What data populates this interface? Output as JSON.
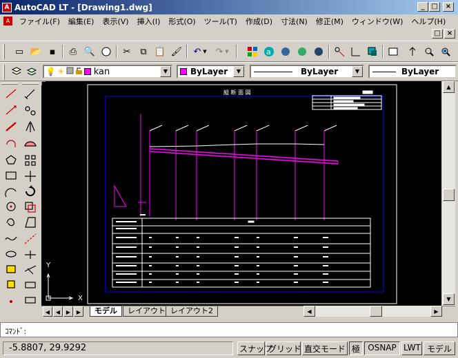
{
  "window": {
    "title": "AutoCAD LT - [Drawing1.dwg]",
    "minimize": "_",
    "maximize": "□",
    "close": "×",
    "app_icon": "A"
  },
  "menu": [
    "ファイル(F)",
    "編集(E)",
    "表示(V)",
    "挿入(I)",
    "形式(O)",
    "ツール(T)",
    "作成(D)",
    "寸法(N)",
    "修正(M)",
    "ウィンドウ(W)",
    "ヘルプ(H)"
  ],
  "layer": {
    "name": "kan",
    "color": "#ff00ff"
  },
  "props": {
    "color": "ByLayer",
    "linetype": "ByLayer",
    "lineweight": "ByLayer"
  },
  "drawing": {
    "title": "縦 断 面 図"
  },
  "ucs": {
    "x": "X",
    "y": "Y"
  },
  "tabs": [
    "モデル",
    "レイアウト1",
    "レイアウト2"
  ],
  "command": {
    "prompt": "ｺﾏﾝﾄﾞ:"
  },
  "status": {
    "coords": "-5.8807, 29.9292",
    "snap": "スナップ",
    "grid": "グリッド",
    "ortho": "直交モード",
    "polar": "極",
    "osnap": "OSNAP",
    "lwt": "LWT",
    "model": "モデル"
  },
  "icons": {
    "new": "▭",
    "open": "📂",
    "save": "▪",
    "print": "⎙",
    "preview": "🔍",
    "cut": "✂",
    "copy": "⧉",
    "paste": "📋",
    "match": "🖌",
    "undo": "↶",
    "redo": "↷",
    "arrow_down": "▼",
    "arrow_up": "▲",
    "arrow_left": "◀",
    "arrow_right": "▶"
  }
}
